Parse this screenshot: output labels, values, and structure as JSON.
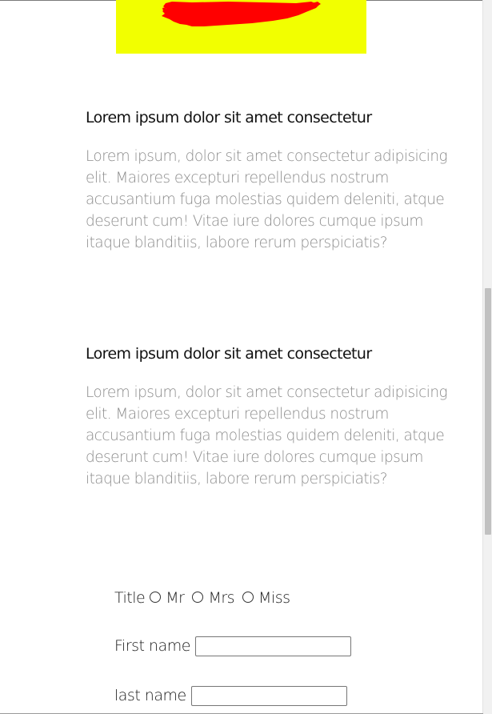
{
  "hero": {
    "image_name": "yellow-banner-with-red-brush-stroke",
    "colors": {
      "background": "#f2ff00",
      "stroke": "#ff0000"
    }
  },
  "sections": [
    {
      "heading": "Lorem ipsum dolor sit amet consectetur",
      "body": "Lorem ipsum, dolor sit amet consectetur adipisicing elit. Maiores excepturi repellendus nostrum accusantium fuga molestias quidem deleniti, atque deserunt cum! Vitae iure dolores cumque ipsum itaque blanditiis, labore rerum perspiciatis?"
    },
    {
      "heading": "Lorem ipsum dolor sit amet consectetur",
      "body": "Lorem ipsum, dolor sit amet consectetur adipisicing elit. Maiores excepturi repellendus nostrum accusantium fuga molestias quidem deleniti, atque deserunt cum! Vitae iure dolores cumque ipsum itaque blanditiis, labore rerum perspiciatis?"
    }
  ],
  "form": {
    "title_label": "Title",
    "title_options": [
      "Mr",
      "Mrs",
      "Miss"
    ],
    "first_name_label": "First name",
    "first_name_value": "",
    "last_name_label": "last name",
    "last_name_value": ""
  }
}
